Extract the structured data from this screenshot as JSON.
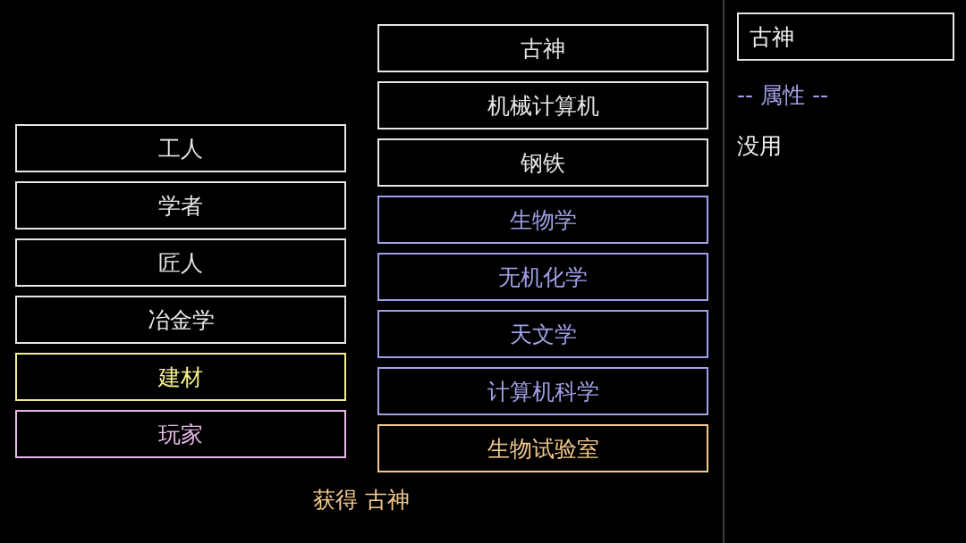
{
  "left_column": {
    "items": [
      {
        "label": "工人",
        "color": "#e6e6e6"
      },
      {
        "label": "学者",
        "color": "#e6e6e6"
      },
      {
        "label": "匠人",
        "color": "#e6e6e6"
      },
      {
        "label": "冶金学",
        "color": "#e6e6e6"
      },
      {
        "label": "建材",
        "color": "#f2f08c"
      },
      {
        "label": "玩家",
        "color": "#e8b8e8"
      }
    ]
  },
  "middle_column": {
    "items": [
      {
        "label": "古神",
        "color": "#e6e6e6"
      },
      {
        "label": "机械计算机",
        "color": "#e6e6e6"
      },
      {
        "label": "钢铁",
        "color": "#e6e6e6"
      },
      {
        "label": "生物学",
        "color": "#a0a0e8"
      },
      {
        "label": "无机化学",
        "color": "#a0a0e8"
      },
      {
        "label": "天文学",
        "color": "#a0a0e8"
      },
      {
        "label": "计算机科学",
        "color": "#a0a0e8"
      },
      {
        "label": "生物试验室",
        "color": "#f2c88c"
      }
    ]
  },
  "message": "获得 古神",
  "details_panel": {
    "title": "古神",
    "section_heading": "-- 属性 --",
    "attributes": [
      "没用"
    ]
  }
}
